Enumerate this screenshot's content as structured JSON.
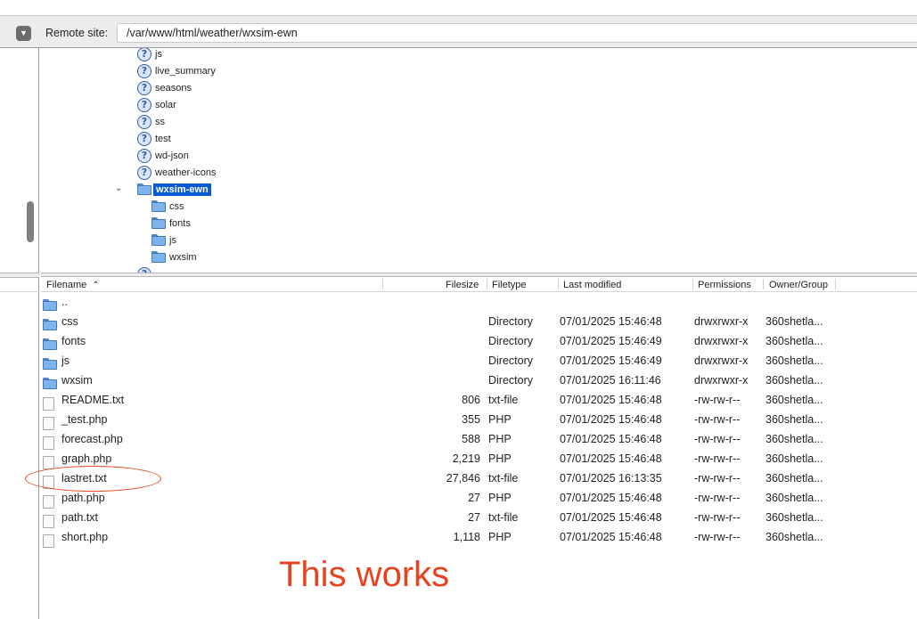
{
  "remote_site": {
    "label": "Remote site:",
    "path": "/var/www/html/weather/wxsim-ewn",
    "dropdown_icon": "chevron-down-icon"
  },
  "tree": [
    {
      "name": "js",
      "icon": "question-icon",
      "depth": 0
    },
    {
      "name": "live_summary",
      "icon": "question-icon",
      "depth": 0
    },
    {
      "name": "seasons",
      "icon": "question-icon",
      "depth": 0
    },
    {
      "name": "solar",
      "icon": "question-icon",
      "depth": 0
    },
    {
      "name": "ss",
      "icon": "question-icon",
      "depth": 0
    },
    {
      "name": "test",
      "icon": "question-icon",
      "depth": 0
    },
    {
      "name": "wd-json",
      "icon": "question-icon",
      "depth": 0
    },
    {
      "name": "weather-icons",
      "icon": "question-icon",
      "depth": 0
    },
    {
      "name": "wxsim-ewn",
      "icon": "folder-open-icon",
      "depth": 0,
      "selected": true,
      "expanded": true
    },
    {
      "name": "css",
      "icon": "folder-icon",
      "depth": 1
    },
    {
      "name": "fonts",
      "icon": "folder-icon",
      "depth": 1
    },
    {
      "name": "js",
      "icon": "folder-icon",
      "depth": 1
    },
    {
      "name": "wxsim",
      "icon": "folder-icon",
      "depth": 1
    }
  ],
  "columns": {
    "filename": "Filename",
    "filesize": "Filesize",
    "filetype": "Filetype",
    "last_modified": "Last modified",
    "permissions": "Permissions",
    "owner_group": "Owner/Group"
  },
  "files": [
    {
      "name": "..",
      "size": "",
      "type": "",
      "modified": "",
      "perms": "",
      "owner": "",
      "icon": "folder-icon"
    },
    {
      "name": "css",
      "size": "",
      "type": "Directory",
      "modified": "07/01/2025 15:46:48",
      "perms": "drwxrwxr-x",
      "owner": "360shetla...",
      "icon": "folder-icon"
    },
    {
      "name": "fonts",
      "size": "",
      "type": "Directory",
      "modified": "07/01/2025 15:46:49",
      "perms": "drwxrwxr-x",
      "owner": "360shetla...",
      "icon": "folder-icon"
    },
    {
      "name": "js",
      "size": "",
      "type": "Directory",
      "modified": "07/01/2025 15:46:49",
      "perms": "drwxrwxr-x",
      "owner": "360shetla...",
      "icon": "folder-icon"
    },
    {
      "name": "wxsim",
      "size": "",
      "type": "Directory",
      "modified": "07/01/2025 16:11:46",
      "perms": "drwxrwxr-x",
      "owner": "360shetla...",
      "icon": "folder-icon"
    },
    {
      "name": "README.txt",
      "size": "806",
      "type": "txt-file",
      "modified": "07/01/2025 15:46:48",
      "perms": "-rw-rw-r--",
      "owner": "360shetla...",
      "icon": "file-icon"
    },
    {
      "name": "_test.php",
      "size": "355",
      "type": "PHP",
      "modified": "07/01/2025 15:46:48",
      "perms": "-rw-rw-r--",
      "owner": "360shetla...",
      "icon": "file-icon"
    },
    {
      "name": "forecast.php",
      "size": "588",
      "type": "PHP",
      "modified": "07/01/2025 15:46:48",
      "perms": "-rw-rw-r--",
      "owner": "360shetla...",
      "icon": "file-icon"
    },
    {
      "name": "graph.php",
      "size": "2,219",
      "type": "PHP",
      "modified": "07/01/2025 15:46:48",
      "perms": "-rw-rw-r--",
      "owner": "360shetla...",
      "icon": "file-icon"
    },
    {
      "name": "lastret.txt",
      "size": "27,846",
      "type": "txt-file",
      "modified": "07/01/2025 16:13:35",
      "perms": "-rw-rw-r--",
      "owner": "360shetla...",
      "icon": "file-icon"
    },
    {
      "name": "path.php",
      "size": "27",
      "type": "PHP",
      "modified": "07/01/2025 15:46:48",
      "perms": "-rw-rw-r--",
      "owner": "360shetla...",
      "icon": "file-icon"
    },
    {
      "name": "path.txt",
      "size": "27",
      "type": "txt-file",
      "modified": "07/01/2025 15:46:48",
      "perms": "-rw-rw-r--",
      "owner": "360shetla...",
      "icon": "file-icon"
    },
    {
      "name": "short.php",
      "size": "1,118",
      "type": "PHP",
      "modified": "07/01/2025 15:46:48",
      "perms": "-rw-rw-r--",
      "owner": "360shetla...",
      "icon": "file-icon"
    }
  ],
  "annotation": {
    "text": "This works",
    "color": "#e8431e"
  },
  "colors": {
    "selection": "#0a5bd1",
    "folder": "#7eb4ea"
  }
}
